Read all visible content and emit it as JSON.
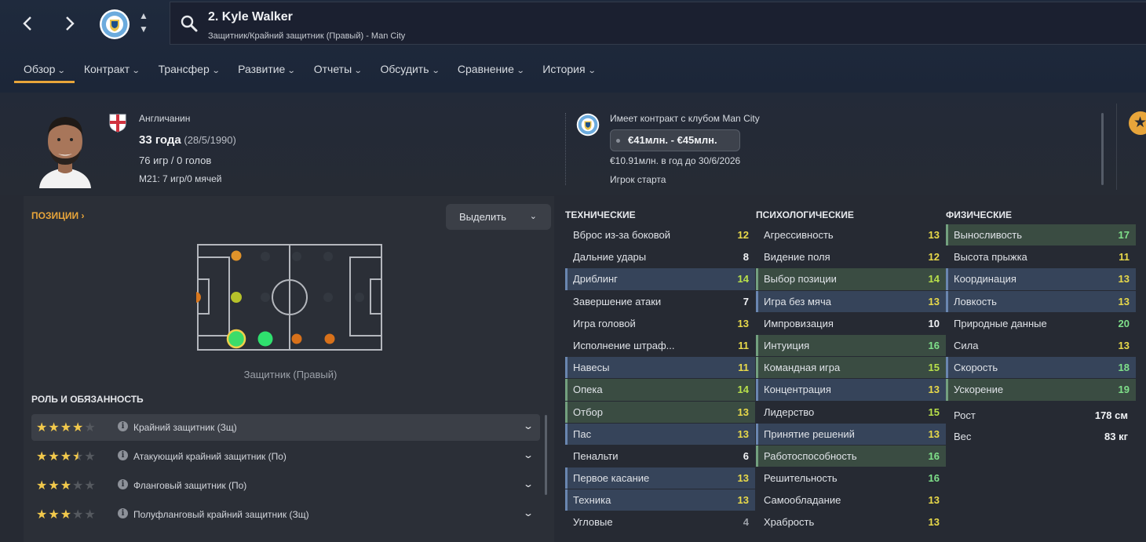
{
  "header": {
    "player_title": "2. Kyle Walker",
    "player_subtitle": "Защитник/Крайний защитник (Правый) - Man City",
    "nav_back": "‹",
    "nav_forward": "›"
  },
  "tabs": [
    {
      "label": "Обзор"
    },
    {
      "label": "Контракт"
    },
    {
      "label": "Трансфер"
    },
    {
      "label": "Развитие"
    },
    {
      "label": "Отчеты"
    },
    {
      "label": "Обсудить"
    },
    {
      "label": "Сравнение"
    },
    {
      "label": "История"
    }
  ],
  "profile": {
    "nationality": "Англичанин",
    "age": "33 года",
    "dob": "(28/5/1990)",
    "apps_goals": "76 игр / 0 голов",
    "u21": "M21: 7 игр/0 мячей"
  },
  "contract": {
    "club_line": "Имеет контракт с клубом Man City",
    "value_range": "€41млн. - €45млн.",
    "wage_line": "€10.91млн. в год до 30/6/2026",
    "status": "Игрок старта"
  },
  "positions": {
    "title": "ПОЗИЦИИ",
    "highlight_label": "Выделить",
    "caption": "Защитник (Правый)"
  },
  "roles": {
    "title": "РОЛЬ И ОБЯЗАННОСТЬ",
    "items": [
      {
        "name": "Крайний защитник (Зщ)",
        "stars": 4
      },
      {
        "name": "Атакующий крайний защитник (По)",
        "stars": 3.5
      },
      {
        "name": "Фланговый защитник (По)",
        "stars": 3
      },
      {
        "name": "Полуфланговый крайний защитник (Зщ)",
        "stars": 3
      }
    ]
  },
  "attributes": {
    "technical": {
      "title": "ТЕХНИЧЕСКИЕ",
      "items": [
        {
          "name": "Вброс из-за боковой",
          "value": "12",
          "hl": ""
        },
        {
          "name": "Дальние удары",
          "value": "8",
          "hl": ""
        },
        {
          "name": "Дриблинг",
          "value": "14",
          "hl": "blue"
        },
        {
          "name": "Завершение атаки",
          "value": "7",
          "hl": ""
        },
        {
          "name": "Игра головой",
          "value": "13",
          "hl": ""
        },
        {
          "name": "Исполнение штраф...",
          "value": "11",
          "hl": ""
        },
        {
          "name": "Навесы",
          "value": "11",
          "hl": "blue"
        },
        {
          "name": "Опека",
          "value": "14",
          "hl": "green"
        },
        {
          "name": "Отбор",
          "value": "13",
          "hl": "green"
        },
        {
          "name": "Пас",
          "value": "13",
          "hl": "blue"
        },
        {
          "name": "Пенальти",
          "value": "6",
          "hl": ""
        },
        {
          "name": "Первое касание",
          "value": "13",
          "hl": "blue"
        },
        {
          "name": "Техника",
          "value": "13",
          "hl": "blue"
        },
        {
          "name": "Угловые",
          "value": "4",
          "hl": ""
        }
      ]
    },
    "mental": {
      "title": "ПСИХОЛОГИЧЕСКИЕ",
      "items": [
        {
          "name": "Агрессивность",
          "value": "13",
          "hl": ""
        },
        {
          "name": "Видение поля",
          "value": "12",
          "hl": ""
        },
        {
          "name": "Выбор позиции",
          "value": "14",
          "hl": "green"
        },
        {
          "name": "Игра без мяча",
          "value": "13",
          "hl": "blue"
        },
        {
          "name": "Импровизация",
          "value": "10",
          "hl": ""
        },
        {
          "name": "Интуиция",
          "value": "16",
          "hl": "green"
        },
        {
          "name": "Командная игра",
          "value": "15",
          "hl": "green"
        },
        {
          "name": "Концентрация",
          "value": "13",
          "hl": "blue"
        },
        {
          "name": "Лидерство",
          "value": "15",
          "hl": ""
        },
        {
          "name": "Принятие решений",
          "value": "13",
          "hl": "blue"
        },
        {
          "name": "Работоспособность",
          "value": "16",
          "hl": "green"
        },
        {
          "name": "Решительность",
          "value": "16",
          "hl": ""
        },
        {
          "name": "Самообладание",
          "value": "13",
          "hl": ""
        },
        {
          "name": "Храбрость",
          "value": "13",
          "hl": ""
        }
      ]
    },
    "physical": {
      "title": "ФИЗИЧЕСКИЕ",
      "items": [
        {
          "name": "Выносливость",
          "value": "17",
          "hl": "green"
        },
        {
          "name": "Высота прыжка",
          "value": "11",
          "hl": ""
        },
        {
          "name": "Координация",
          "value": "13",
          "hl": "blue"
        },
        {
          "name": "Ловкость",
          "value": "13",
          "hl": "blue"
        },
        {
          "name": "Природные данные",
          "value": "20",
          "hl": ""
        },
        {
          "name": "Сила",
          "value": "13",
          "hl": ""
        },
        {
          "name": "Скорость",
          "value": "18",
          "hl": "blue"
        },
        {
          "name": "Ускорение",
          "value": "19",
          "hl": "green"
        }
      ],
      "extras": [
        {
          "name": "Рост",
          "value": "178 см"
        },
        {
          "name": "Вес",
          "value": "83 кг"
        }
      ]
    }
  },
  "colors": {
    "accent": "#e8a53a",
    "value_yellow": "#e8d94a",
    "value_green": "#7fe08a",
    "value_lime": "#b8e04a",
    "value_white": "#f1f3f6",
    "value_grey": "#9ba0a8"
  }
}
